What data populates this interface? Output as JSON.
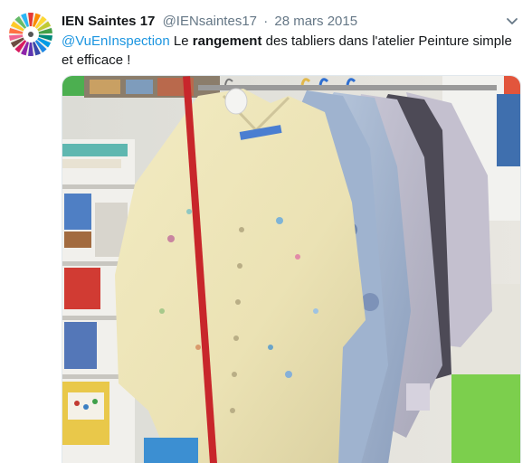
{
  "tweet": {
    "display_name": "IEN Saintes 17",
    "handle": "@IENsaintes17",
    "separator": "·",
    "date": "28 mars 2015",
    "text_parts": {
      "mention": "@VuEnInspection",
      "before_bold": " Le ",
      "bold": "rangement",
      "after_bold": " des tabliers dans l'atelier Peinture simple et efficace !"
    },
    "avatar_icon": "colored-pencils-circle-icon",
    "menu_icon": "chevron-down-icon",
    "media_description_icon": "photo"
  },
  "colors": {
    "link": "#1b95e0",
    "text": "#14171a",
    "secondary": "#657786",
    "border": "#e1e8ed"
  }
}
